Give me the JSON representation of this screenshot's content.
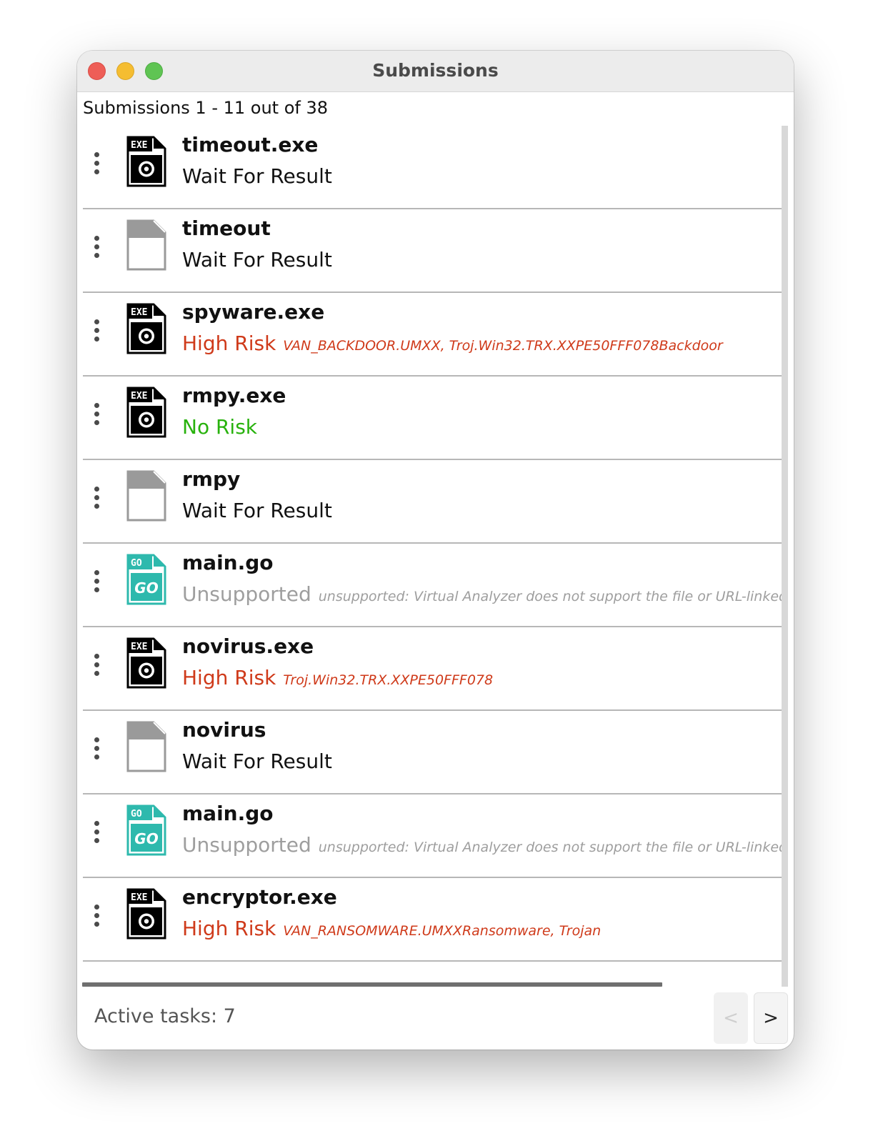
{
  "window": {
    "title": "Submissions"
  },
  "summary": "Submissions 1 - 11 out of 38",
  "icons": {
    "exe_badge": "EXE",
    "go_badge": "GO",
    "go_logo": "GO"
  },
  "colors": {
    "high_risk": "#cf3a1a",
    "no_risk": "#28b20d",
    "unsupported": "#9e9e9e",
    "go_file": "#2eb9ad"
  },
  "submissions": [
    {
      "name": "timeout.exe",
      "icon": "exe-file-icon",
      "status": "Wait For Result",
      "detail": ""
    },
    {
      "name": "timeout",
      "icon": "blank-file-icon",
      "status": "Wait For Result",
      "detail": ""
    },
    {
      "name": "spyware.exe",
      "icon": "exe-file-icon",
      "status": "High Risk",
      "detail": "VAN_BACKDOOR.UMXX, Troj.Win32.TRX.XXPE50FFF078Backdoor"
    },
    {
      "name": "rmpy.exe",
      "icon": "exe-file-icon",
      "status": "No Risk",
      "detail": ""
    },
    {
      "name": "rmpy",
      "icon": "blank-file-icon",
      "status": "Wait For Result",
      "detail": ""
    },
    {
      "name": "main.go",
      "icon": "go-file-icon",
      "status": "Unsupported",
      "detail": "unsupported: Virtual Analyzer does not support the file or URL-linked file form"
    },
    {
      "name": "novirus.exe",
      "icon": "exe-file-icon",
      "status": "High Risk",
      "detail": "Troj.Win32.TRX.XXPE50FFF078"
    },
    {
      "name": "novirus",
      "icon": "blank-file-icon",
      "status": "Wait For Result",
      "detail": ""
    },
    {
      "name": "main.go",
      "icon": "go-file-icon",
      "status": "Unsupported",
      "detail": "unsupported: Virtual Analyzer does not support the file or URL-linked file form"
    },
    {
      "name": "encryptor.exe",
      "icon": "exe-file-icon",
      "status": "High Risk",
      "detail": "VAN_RANSOMWARE.UMXXRansomware, Trojan"
    }
  ],
  "footer": {
    "active_tasks": "Active tasks: 7",
    "prev_label": "<",
    "next_label": ">"
  }
}
